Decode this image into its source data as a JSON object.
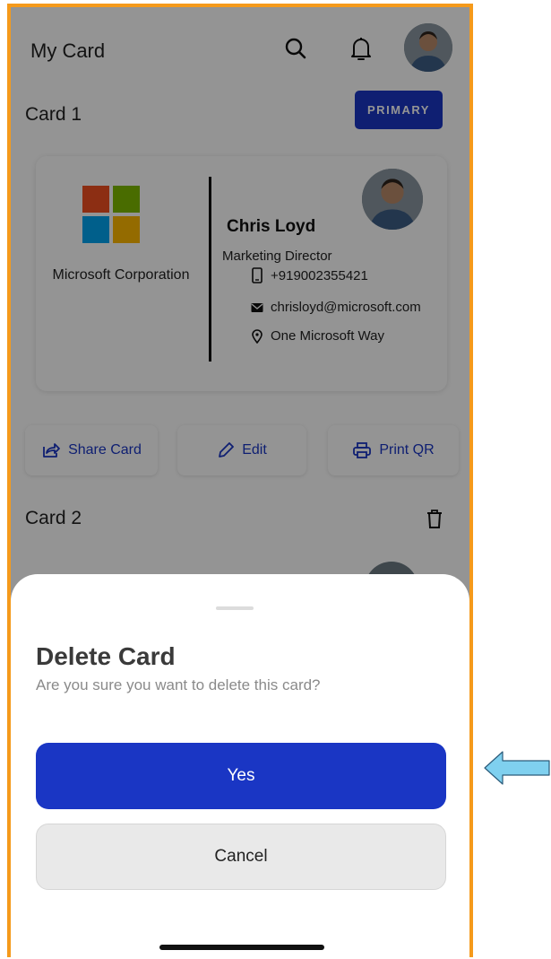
{
  "header": {
    "title": "My Card",
    "search_icon": "search-icon",
    "bell_icon": "bell-icon"
  },
  "card1": {
    "title": "Card 1",
    "badge": "PRIMARY",
    "company": "Microsoft Corporation",
    "name": "Chris Loyd",
    "role": "Marketing Director",
    "phone": "+919002355421",
    "email": "chrisloyd@microsoft.com",
    "address": "One Microsoft Way"
  },
  "actions": {
    "share": "Share Card",
    "edit": "Edit",
    "print": "Print QR"
  },
  "card2": {
    "title": "Card 2"
  },
  "dialog": {
    "title": "Delete Card",
    "message": "Are you sure you want to delete this card?",
    "yes": "Yes",
    "cancel": "Cancel"
  },
  "colors": {
    "accent": "#1a36c4",
    "frame": "#f59a1b",
    "pointer": "#7fd0ef"
  }
}
